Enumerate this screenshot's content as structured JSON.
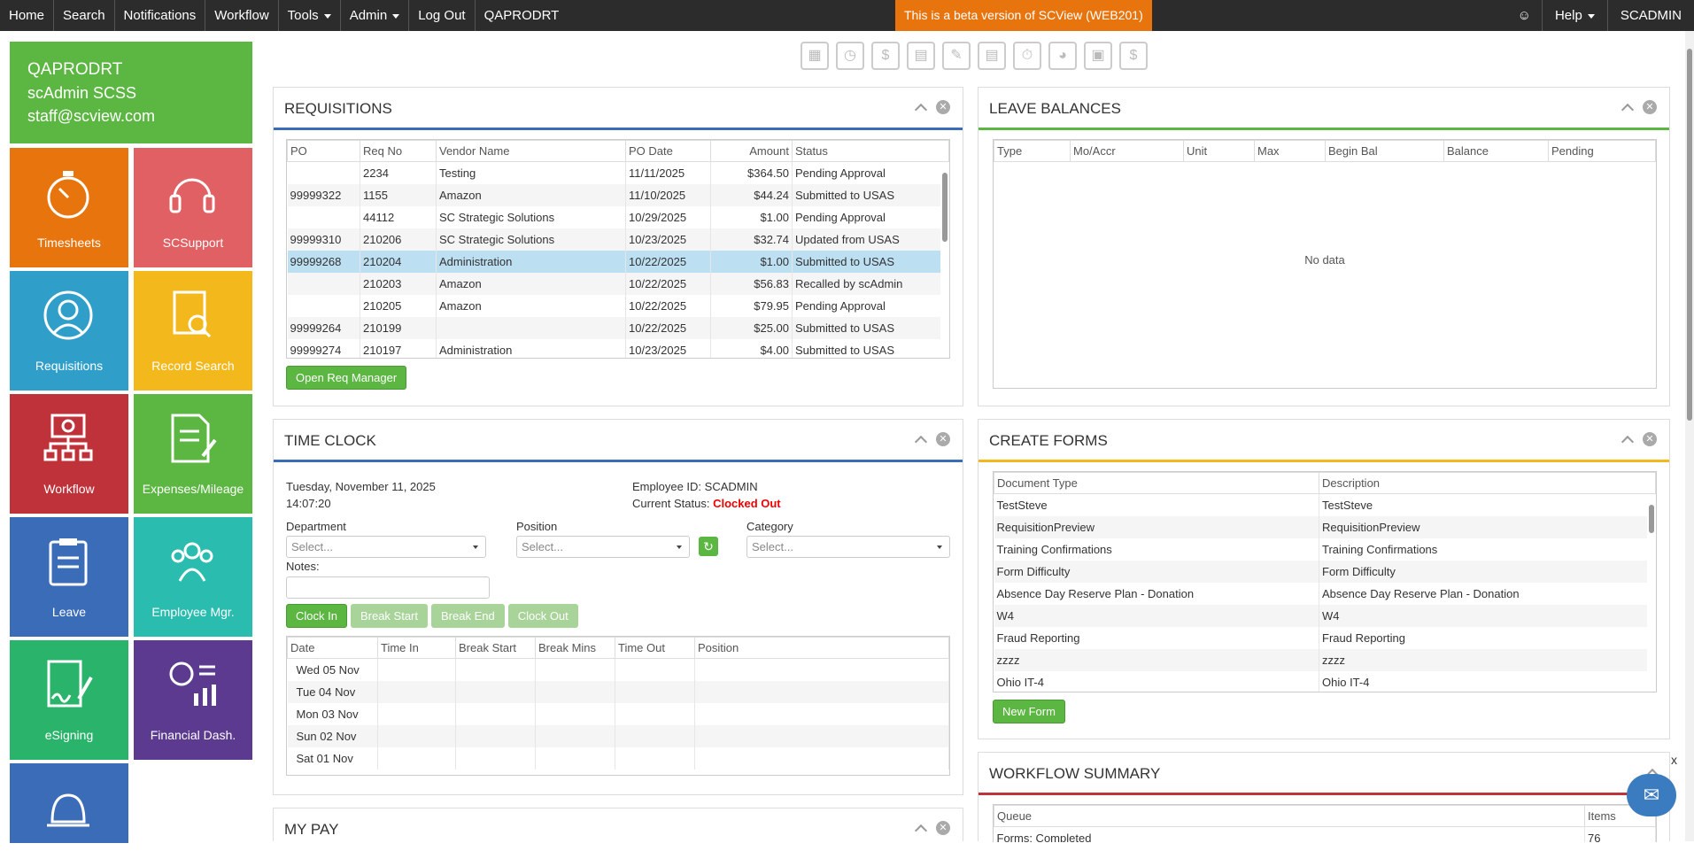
{
  "topbar": {
    "nav": [
      "Home",
      "Search",
      "Notifications",
      "Workflow",
      "Tools",
      "Admin",
      "Log Out",
      "QAPRODRT"
    ],
    "beta_banner": "This is a beta version of SCView (WEB201)",
    "help_label": "Help",
    "user_label": "SCADMIN",
    "smile_icon": "smiley-icon"
  },
  "profile": {
    "line1": "QAPRODRT",
    "line2": "scAdmin SCSS",
    "line3": "staff@scview.com"
  },
  "tiles": [
    {
      "label": "Timesheets",
      "color": "#e8740e",
      "icon": "stopwatch-icon"
    },
    {
      "label": "SCSupport",
      "color": "#e06063",
      "icon": "headset-icon"
    },
    {
      "label": "Requisitions",
      "color": "#2f9fc9",
      "icon": "person-icon"
    },
    {
      "label": "Record Search",
      "color": "#f3b91c",
      "icon": "document-search-icon"
    },
    {
      "label": "Workflow",
      "color": "#c0323a",
      "icon": "workflow-icon"
    },
    {
      "label": "Expenses/Mileage",
      "color": "#5cb642",
      "icon": "document-pen-icon"
    },
    {
      "label": "Leave",
      "color": "#3a6cb8",
      "icon": "clipboard-icon"
    },
    {
      "label": "Employee Mgr.",
      "color": "#2bbcb0",
      "icon": "group-icon"
    },
    {
      "label": "eSigning",
      "color": "#2ab36a",
      "icon": "signature-icon"
    },
    {
      "label": "Financial Dash.",
      "color": "#5b3a8f",
      "icon": "dashboard-icon"
    },
    {
      "label": "",
      "color": "#3a6cb8",
      "icon": "bell-icon"
    }
  ],
  "requisitions": {
    "title": "REQUISITIONS",
    "columns": [
      "PO",
      "Req No",
      "Vendor Name",
      "PO Date",
      "Amount",
      "Status"
    ],
    "rows": [
      [
        "",
        "2234",
        "Testing",
        "11/11/2025",
        "$364.50",
        "Pending Approval"
      ],
      [
        "99999322",
        "1155",
        "Amazon",
        "11/10/2025",
        "$44.24",
        "Submitted to USAS"
      ],
      [
        "",
        "44112",
        "SC Strategic Solutions",
        "10/29/2025",
        "$1.00",
        "Pending Approval"
      ],
      [
        "99999310",
        "210206",
        "SC Strategic Solutions",
        "10/23/2025",
        "$32.74",
        "Updated from USAS"
      ],
      [
        "99999268",
        "210204",
        "Administration",
        "10/22/2025",
        "$1.00",
        "Submitted to USAS"
      ],
      [
        "",
        "210203",
        "Amazon",
        "10/22/2025",
        "$56.83",
        "Recalled by scAdmin"
      ],
      [
        "",
        "210205",
        "Amazon",
        "10/22/2025",
        "$79.95",
        "Pending Approval"
      ],
      [
        "99999264",
        "210199",
        "",
        "10/22/2025",
        "$25.00",
        "Submitted to USAS"
      ],
      [
        "99999274",
        "210197",
        "Administration",
        "10/23/2025",
        "$4.00",
        "Submitted to USAS"
      ]
    ],
    "button": "Open Req Manager"
  },
  "leave": {
    "title": "LEAVE BALANCES",
    "columns": [
      "Type",
      "Mo/Accr",
      "Unit",
      "Max",
      "Begin Bal",
      "Balance",
      "Pending"
    ],
    "empty": "No data"
  },
  "timeclock": {
    "title": "TIME CLOCK",
    "date": "Tuesday, November 11, 2025",
    "time": "14:07:20",
    "employee_id": "Employee ID: SCADMIN",
    "status_label": "Current Status:",
    "status_value": "Clocked Out",
    "department_label": "Department",
    "position_label": "Position",
    "category_label": "Category",
    "select_placeholder": "Select...",
    "notes_label": "Notes:",
    "buttons": [
      "Clock In",
      "Break Start",
      "Break End",
      "Clock Out"
    ],
    "columns": [
      "Date",
      "Time In",
      "Break Start",
      "Break Mins",
      "Time Out",
      "Position"
    ],
    "rows": [
      "Wed 05 Nov",
      "Tue 04 Nov",
      "Mon 03 Nov",
      "Sun 02 Nov",
      "Sat 01 Nov"
    ]
  },
  "create_forms": {
    "title": "CREATE FORMS",
    "columns": [
      "Document Type",
      "Description"
    ],
    "rows": [
      [
        "TestSteve",
        "TestSteve"
      ],
      [
        "RequisitionPreview",
        "RequisitionPreview"
      ],
      [
        "Training Confirmations",
        "Training Confirmations"
      ],
      [
        "Form Difficulty",
        "Form Difficulty"
      ],
      [
        "Absence Day Reserve Plan - Donation",
        "Absence Day Reserve Plan - Donation"
      ],
      [
        "W4",
        "W4"
      ],
      [
        "Fraud Reporting",
        "Fraud Reporting"
      ],
      [
        "zzzz",
        "zzzz"
      ],
      [
        "Ohio IT-4",
        "Ohio IT-4"
      ]
    ],
    "button": "New Form"
  },
  "workflow_summary": {
    "title": "WORKFLOW SUMMARY",
    "columns": [
      "Queue",
      "Items"
    ],
    "partial_row": [
      "Forms: Completed",
      "76"
    ]
  },
  "my_pay": {
    "title": "MY PAY"
  },
  "chat": {
    "close": "x"
  }
}
